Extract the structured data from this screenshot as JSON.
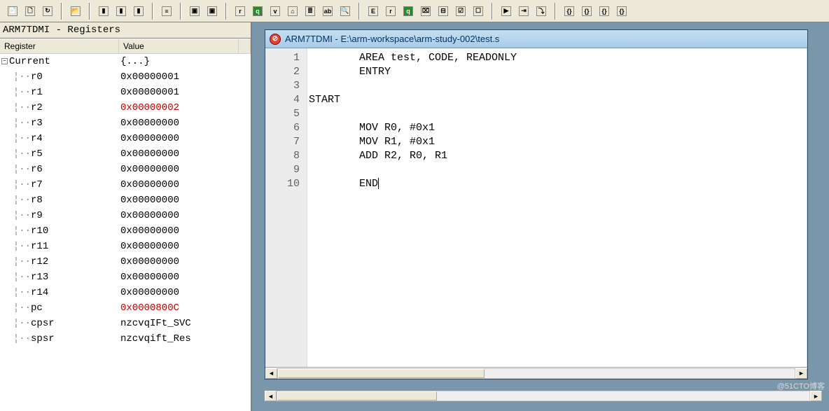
{
  "toolbar": {
    "groups": [
      [
        "file-icon",
        "file-refresh-icon",
        "reload-icon"
      ],
      [
        "open-icon"
      ],
      [
        "disk-icon",
        "disk-arrow-icon",
        "disk-eject-icon"
      ],
      [
        "list-icon"
      ],
      [
        "chip-icon",
        "chip-search-icon"
      ],
      [
        "r-box",
        "q-box-green",
        "v-box",
        "hierarchy-icon",
        "stack-icon",
        "ab-icon",
        "magnify-icon"
      ],
      [
        "panel-e-icon",
        "panel-r-icon",
        "panel-q-green",
        "panel-tree-icon",
        "panel-split-icon",
        "panel-check-icon",
        "panel-uncheck-icon"
      ],
      [
        "run-icon",
        "step-icon",
        "step-over-icon"
      ],
      [
        "brace-run-icon",
        "brace-step-icon",
        "brace-out-icon",
        "brace-stop-icon"
      ]
    ]
  },
  "registers_panel": {
    "title": "ARM7TDMI - Registers",
    "columns": {
      "name": "Register",
      "value": "Value"
    },
    "root": {
      "label": "Current",
      "value": "{...}",
      "expanded": true
    },
    "items": [
      {
        "name": "r0",
        "value": "0x00000001",
        "highlight": false
      },
      {
        "name": "r1",
        "value": "0x00000001",
        "highlight": false
      },
      {
        "name": "r2",
        "value": "0x00000002",
        "highlight": true
      },
      {
        "name": "r3",
        "value": "0x00000000",
        "highlight": false
      },
      {
        "name": "r4",
        "value": "0x00000000",
        "highlight": false
      },
      {
        "name": "r5",
        "value": "0x00000000",
        "highlight": false
      },
      {
        "name": "r6",
        "value": "0x00000000",
        "highlight": false
      },
      {
        "name": "r7",
        "value": "0x00000000",
        "highlight": false
      },
      {
        "name": "r8",
        "value": "0x00000000",
        "highlight": false
      },
      {
        "name": "r9",
        "value": "0x00000000",
        "highlight": false
      },
      {
        "name": "r10",
        "value": "0x00000000",
        "highlight": false
      },
      {
        "name": "r11",
        "value": "0x00000000",
        "highlight": false
      },
      {
        "name": "r12",
        "value": "0x00000000",
        "highlight": false
      },
      {
        "name": "r13",
        "value": "0x00000000",
        "highlight": false
      },
      {
        "name": "r14",
        "value": "0x00000000",
        "highlight": false
      },
      {
        "name": "pc",
        "value": "0x0000800C",
        "highlight": true
      },
      {
        "name": "cpsr",
        "value": "nzcvqIFt_SVC",
        "highlight": false
      },
      {
        "name": "spsr",
        "value": "nzcvqift_Res",
        "highlight": false
      }
    ]
  },
  "editor": {
    "title_prefix": "ARM7TDMI - ",
    "title_path": "E:\\arm-workspace\\arm-study-002\\test.s",
    "lines": [
      "        AREA test, CODE, READONLY",
      "        ENTRY",
      "",
      "START",
      "",
      "        MOV R0, #0x1",
      "        MOV R1, #0x1",
      "        ADD R2, R0, R1",
      "",
      "        END"
    ],
    "cursor_line": 10
  },
  "watermark": "@51CTO博客"
}
